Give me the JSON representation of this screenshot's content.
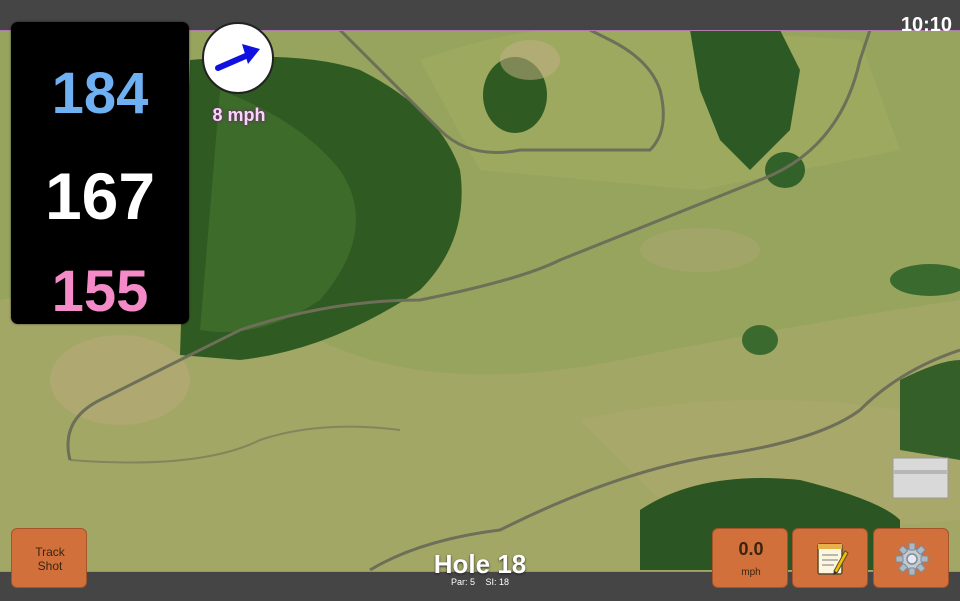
{
  "status": {
    "time": "10:10"
  },
  "yardages": {
    "back": "184",
    "middle": "167",
    "front": "155",
    "colors": {
      "back": "#6fb0f2",
      "middle": "#ffffff",
      "front": "#f58ac9"
    }
  },
  "wind": {
    "speed": "8 mph",
    "icon": "wind-arrow-icon",
    "arrow_color": "#1010e0"
  },
  "buttons": {
    "track_shot": "Track\nShot",
    "speed_value": "0.0",
    "speed_unit": "mph",
    "notes_icon": "notepad-icon",
    "settings_icon": "gear-icon"
  },
  "hole": {
    "title": "Hole 18",
    "par_text": "Par: 5",
    "si_text": "SI: 18"
  }
}
